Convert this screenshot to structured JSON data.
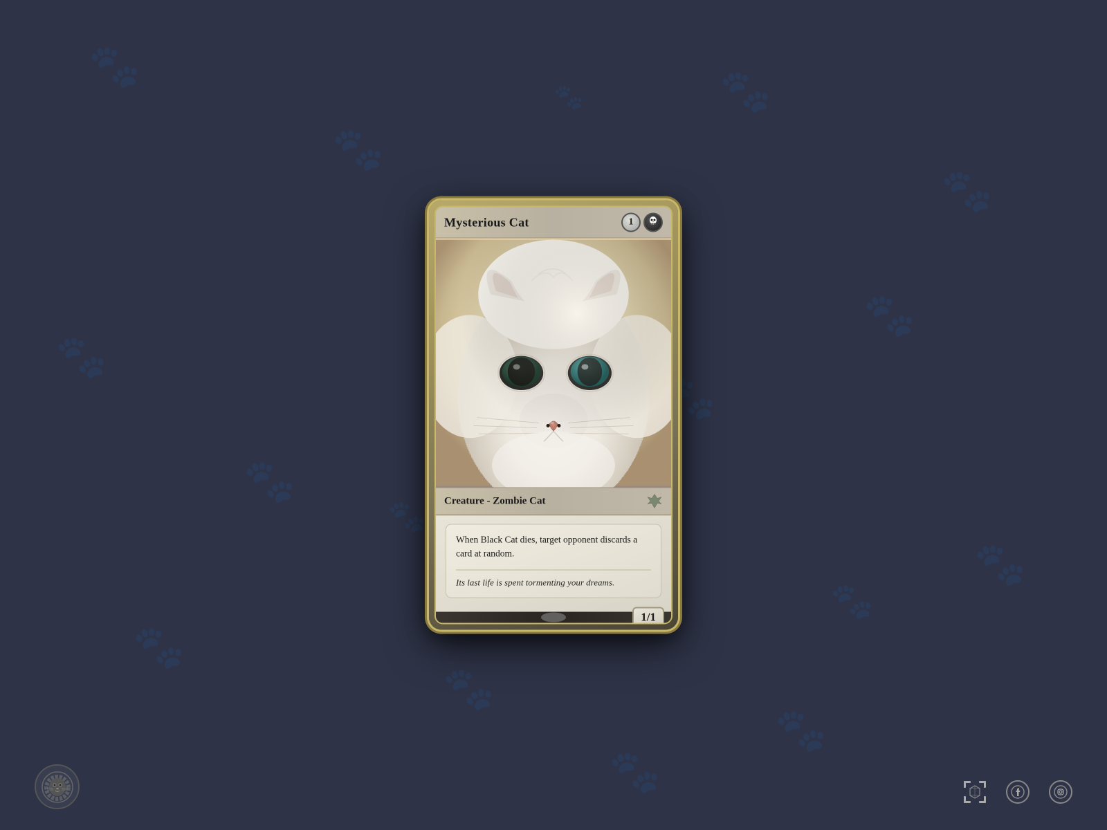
{
  "background": {
    "color": "#2e3347"
  },
  "card": {
    "title": "Mysterious Cat",
    "cost": {
      "colorless": "1",
      "black_symbol": "☠"
    },
    "art_description": "White fluffy cat with heterochromatic eyes",
    "type_line": "Creature - Zombie Cat",
    "rules_text": "When Black Cat dies, target opponent discards a card at random.",
    "flavor_text": "Its last life is spent tormenting your dreams.",
    "power_toughness": "1/1",
    "set_symbol": "crown"
  },
  "bottom": {
    "logo_alt": "Lion face logo",
    "icons": {
      "ar_label": "AR view",
      "facebook_label": "Facebook",
      "instagram_label": "Instagram"
    }
  }
}
